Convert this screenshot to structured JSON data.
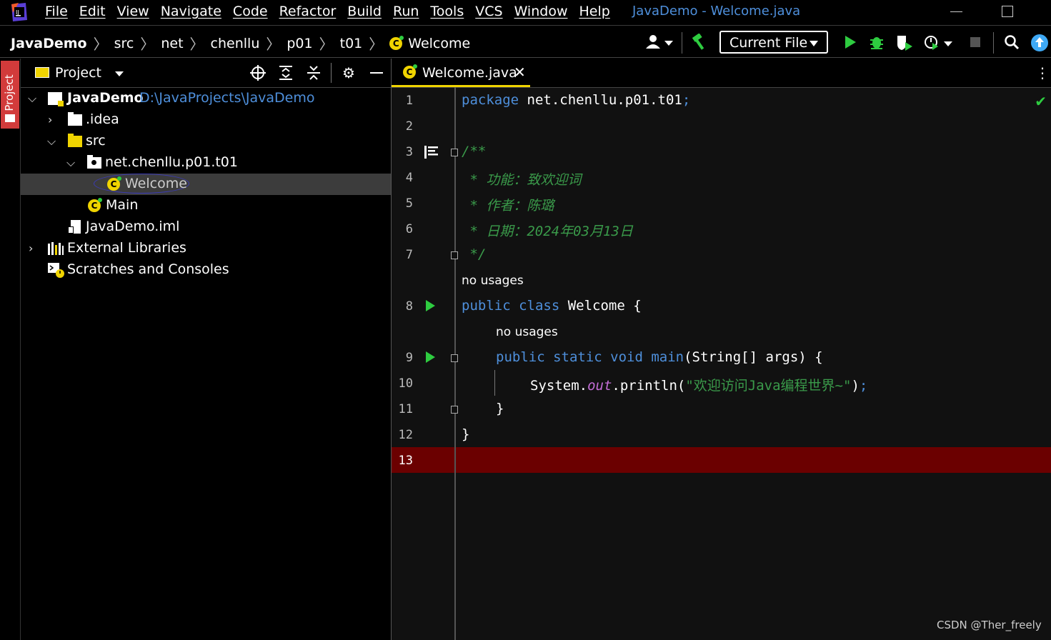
{
  "titlebar": {
    "menu": [
      "File",
      "Edit",
      "View",
      "Navigate",
      "Code",
      "Refactor",
      "Build",
      "Run",
      "Tools",
      "VCS",
      "Window",
      "Help"
    ],
    "window_title": "JavaDemo - Welcome.java"
  },
  "navbar": {
    "breadcrumbs": [
      "JavaDemo",
      "src",
      "net",
      "chenllu",
      "p01",
      "t01",
      "Welcome"
    ],
    "run_config": "Current File"
  },
  "left_strip": {
    "project_tab": "Project"
  },
  "project_panel": {
    "title": "Project",
    "tree": [
      {
        "label": "JavaDemo",
        "path": "D:\\JavaProjects\\JavaDemo"
      },
      {
        "label": ".idea"
      },
      {
        "label": "src"
      },
      {
        "label": "net.chenllu.p01.t01"
      },
      {
        "label": "Welcome"
      },
      {
        "label": "Main"
      },
      {
        "label": "JavaDemo.iml"
      },
      {
        "label": "External Libraries"
      },
      {
        "label": "Scratches and Consoles"
      }
    ]
  },
  "editor": {
    "tab_label": "Welcome.java",
    "line_numbers": [
      "1",
      "2",
      "3",
      "4",
      "5",
      "6",
      "7",
      "8",
      "9",
      "10",
      "11",
      "12",
      "13"
    ],
    "hints": {
      "class_usage": "no usages",
      "method_usage": "no usages"
    },
    "code": {
      "l1_kw": "package",
      "l1_rest": " net.chenllu.p01.t01",
      "l1_semi": ";",
      "l3": "/**",
      "l4": " * 功能：致欢迎词",
      "l5": " * 作者：陈璐",
      "l6": " * 日期：2024年03月13日",
      "l7": " */",
      "l8_kw": "public class",
      "l8_rest": " Welcome {",
      "l9_kw": "public static void",
      "l9_name": " main",
      "l9_rest": "(String[] args) {",
      "l10_a": "System.",
      "l10_out": "out",
      "l10_b": ".println(",
      "l10_str": "\"欢迎访问Java编程世界~\"",
      "l10_c": ")",
      "l10_semi": ";",
      "l11": "}",
      "l12": "}"
    }
  },
  "watermark": "CSDN @Ther_freely"
}
